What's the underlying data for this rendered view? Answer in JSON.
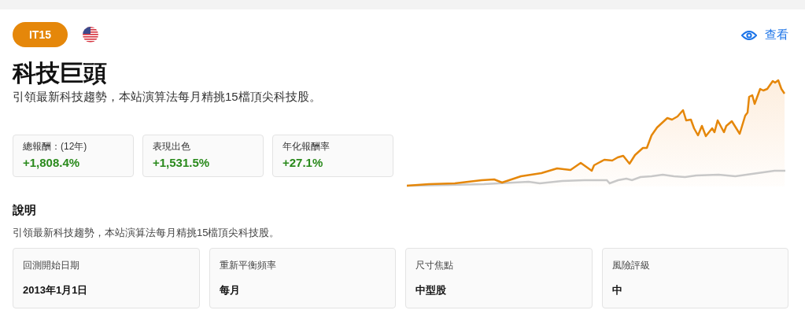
{
  "header": {
    "badge": "IT15",
    "view_link": "查看"
  },
  "title": "科技巨頭",
  "subtitle": "引領最新科技趨勢，本站演算法每月精挑15檔頂尖科技股。",
  "stats": [
    {
      "label": "總報酬：(12年)",
      "value": "+1,808.4%"
    },
    {
      "label": "表現出色",
      "value": "+1,531.5%"
    },
    {
      "label": "年化報酬率",
      "value": "+27.1%"
    }
  ],
  "description": {
    "heading": "說明",
    "text": "引領最新科技趨勢，本站演算法每月精挑15檔頂尖科技股。"
  },
  "details": [
    {
      "label": "回測開始日期",
      "value": "2013年1月1日"
    },
    {
      "label": "重新平衡頻率",
      "value": "每月"
    },
    {
      "label": "尺寸焦點",
      "value": "中型股"
    },
    {
      "label": "風險評級",
      "value": "中"
    }
  ]
}
